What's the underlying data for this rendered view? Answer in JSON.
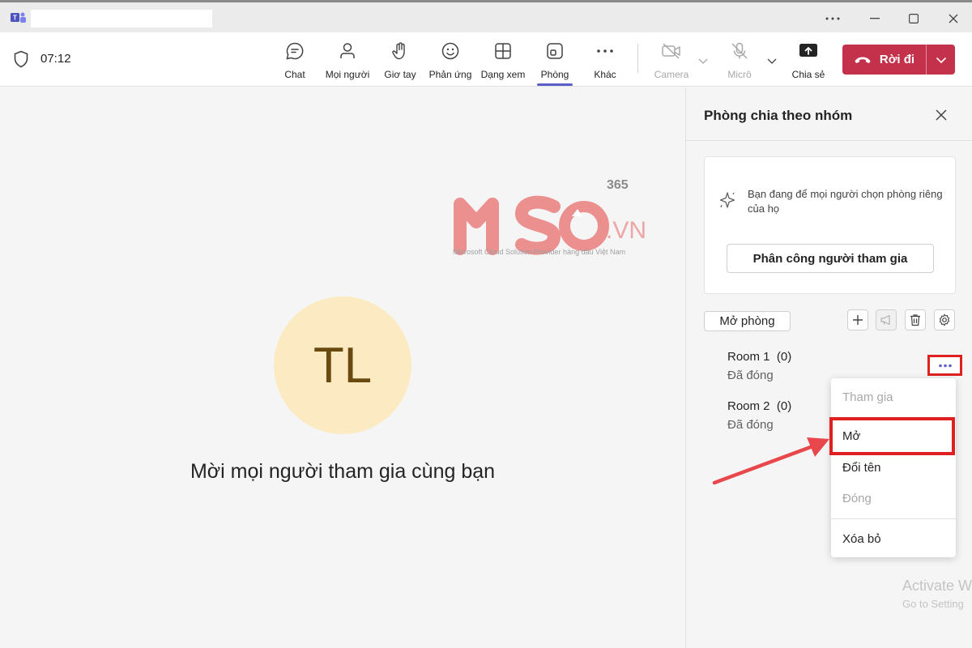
{
  "window": {
    "app_icon": "teams-icon",
    "controls": [
      "more-icon",
      "minimize-icon",
      "maximize-icon",
      "close-icon"
    ]
  },
  "meeting": {
    "timer": "07:12"
  },
  "toolbar": {
    "chat": "Chat",
    "people": "Mọi người",
    "raise_hand": "Giơ tay",
    "react": "Phản ứng",
    "view": "Dạng xem",
    "rooms": "Phòng",
    "more": "Khác",
    "camera": "Camera",
    "mic": "Micrô",
    "share": "Chia sẻ",
    "leave": "Rời đi"
  },
  "stage": {
    "avatar_initials": "TL",
    "invite_text": "Mời mọi người tham gia cùng bạn"
  },
  "watermark": {
    "brand": "MSO",
    "superscript": "365",
    "suffix": ".VN",
    "tagline": "Microsoft Cloud Solution Provider hàng đầu Việt Nam"
  },
  "panel": {
    "title": "Phòng chia theo nhóm",
    "info_text": "Bạn đang để mọi người chọn phòng riêng của họ",
    "assign_button": "Phân công người tham gia",
    "open_rooms_button": "Mở phòng",
    "rooms": [
      {
        "name": "Room 1",
        "count": "(0)",
        "status": "Đã đóng"
      },
      {
        "name": "Room 2",
        "count": "(0)",
        "status": "Đã đóng"
      }
    ]
  },
  "menu": {
    "join": "Tham gia",
    "open": "Mở",
    "rename": "Đổi tên",
    "close": "Đóng",
    "delete": "Xóa bỏ"
  },
  "os_overlay": {
    "line1": "Activate W",
    "line2": "Go to Setting"
  },
  "colors": {
    "accent": "#5b5fc7",
    "leave": "#c4314b",
    "annotation": "#e02020"
  }
}
